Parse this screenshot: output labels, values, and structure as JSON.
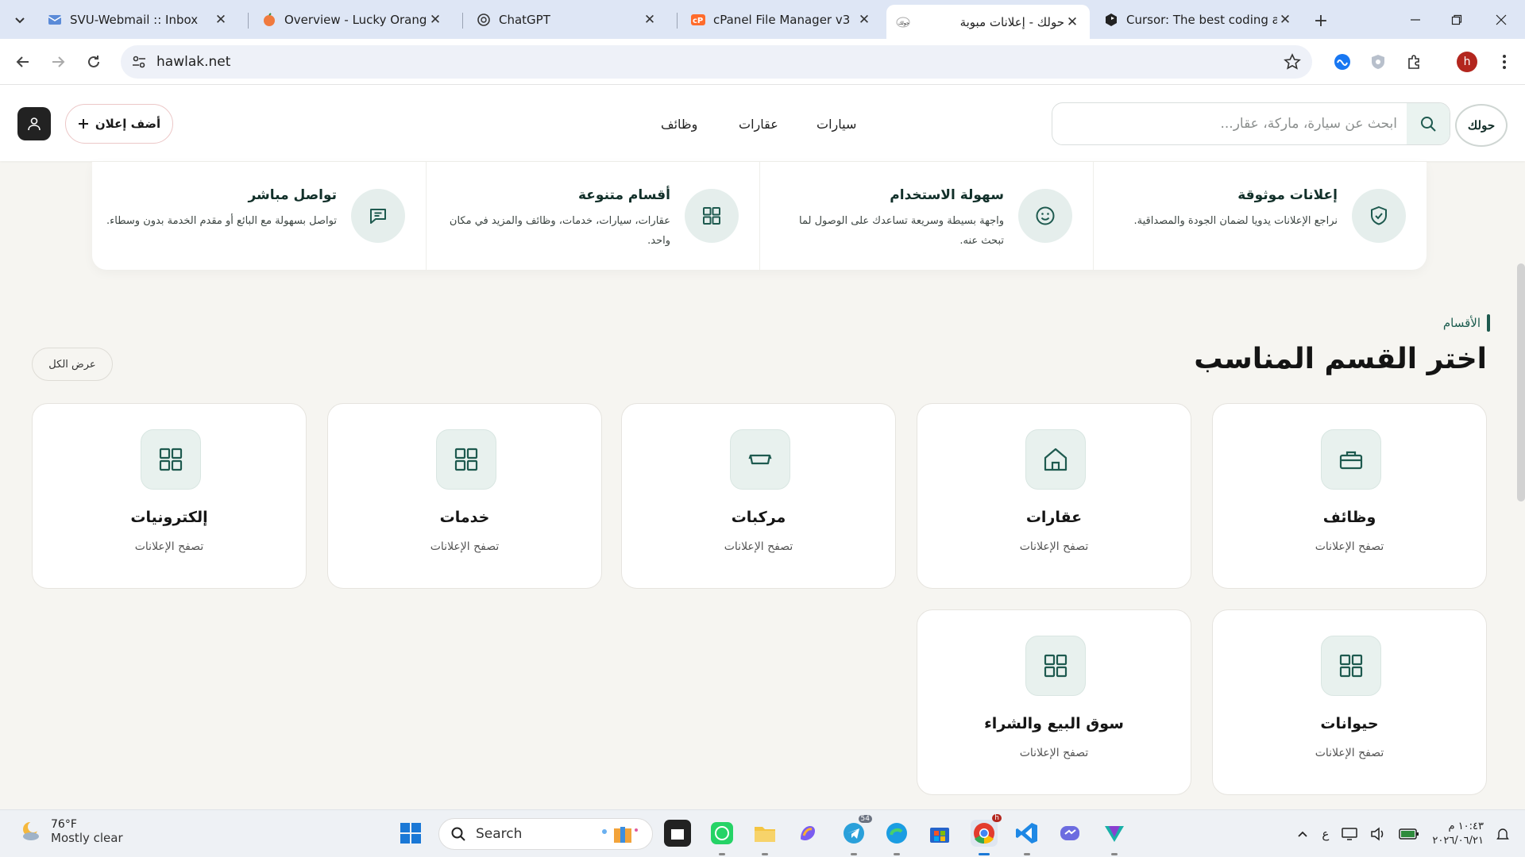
{
  "browser": {
    "tabs": [
      {
        "title": "SVU-Webmail :: Inbox",
        "icon": "webmail-favicon"
      },
      {
        "title": "Overview - Lucky Orange",
        "icon": "lucky-orange-favicon"
      },
      {
        "title": "ChatGPT",
        "icon": "chatgpt-favicon"
      },
      {
        "title": "cPanel File Manager v3",
        "icon": "cpanel-favicon"
      },
      {
        "title": "حولك - إعلانات مبوبة",
        "icon": "hawlak-favicon",
        "active": true
      },
      {
        "title": "Cursor: The best coding ag",
        "icon": "cursor-favicon"
      }
    ],
    "url": "hawlak.net",
    "profile_initial": "h"
  },
  "site": {
    "logo_text": "حولك",
    "search_placeholder": "ابحث عن سيارة، ماركة، عقار...",
    "nav": {
      "cars": "سيارات",
      "realestate": "عقارات",
      "jobs": "وظائف"
    },
    "add_listing": "أضف إعلان"
  },
  "features": [
    {
      "title": "إعلانات موثوقة",
      "desc": "نراجع الإعلانات يدويا لضمان الجودة والمصداقية.",
      "icon": "shield-check-icon"
    },
    {
      "title": "سهولة الاستخدام",
      "desc": "واجهة بسيطة وسريعة تساعدك على الوصول لما تبحث عنه.",
      "icon": "smile-icon"
    },
    {
      "title": "أقسام متنوعة",
      "desc": "عقارات، سيارات، خدمات، وظائف والمزيد في مكان واحد.",
      "icon": "grid-icon"
    },
    {
      "title": "تواصل مباشر",
      "desc": "تواصل بسهولة مع البائع أو مقدم الخدمة بدون وسطاء.",
      "icon": "message-icon"
    }
  ],
  "categories_section": {
    "label": "الأقسام",
    "title": "اختر القسم المناسب",
    "view_all": "عرض الكل",
    "items": [
      {
        "title": "وظائف",
        "sub": "تصفح الإعلانات",
        "icon": "briefcase-icon"
      },
      {
        "title": "عقارات",
        "sub": "تصفح الإعلانات",
        "icon": "house-icon"
      },
      {
        "title": "مركبات",
        "sub": "تصفح الإعلانات",
        "icon": "vehicle-icon"
      },
      {
        "title": "خدمات",
        "sub": "تصفح الإعلانات",
        "icon": "grid-icon"
      },
      {
        "title": "إلكترونيات",
        "sub": "تصفح الإعلانات",
        "icon": "grid-icon"
      },
      {
        "title": "حيوانات",
        "sub": "تصفح الإعلانات",
        "icon": "grid-icon"
      },
      {
        "title": "سوق البيع والشراء",
        "sub": "تصفح الإعلانات",
        "icon": "grid-icon"
      }
    ]
  },
  "taskbar": {
    "weather_temp": "76°F",
    "weather_desc": "Mostly clear",
    "search_label": "Search",
    "telegram_badge": "54",
    "chrome_badge": "h",
    "input_lang": "ع",
    "time": "١٠:٤٣ م",
    "date": "٢٠٢٦/٠٦/٢١"
  },
  "colors": {
    "accent": "#1e5a4f",
    "icon_bg": "#e8f1ee",
    "page_bg": "#f6f5f1"
  }
}
